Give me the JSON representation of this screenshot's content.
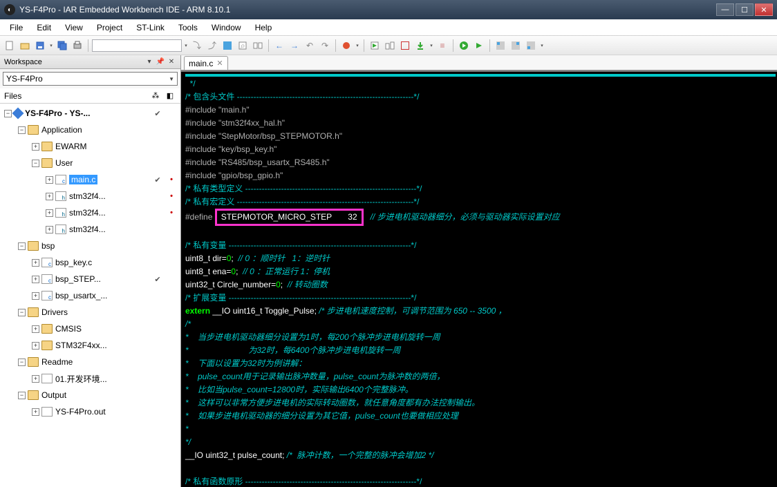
{
  "window": {
    "title": "YS-F4Pro - IAR Embedded Workbench IDE - ARM 8.10.1"
  },
  "menu": [
    "File",
    "Edit",
    "View",
    "Project",
    "ST-Link",
    "Tools",
    "Window",
    "Help"
  ],
  "toolbar": {
    "search_placeholder": ""
  },
  "workspace_panel": {
    "title": "Workspace",
    "selected": "YS-F4Pro"
  },
  "files_panel": {
    "title": "Files"
  },
  "tree": [
    {
      "depth": 0,
      "exp": "-",
      "icon": "cube",
      "label": "YS-F4Pro - YS-...",
      "root": true,
      "cells": [
        "✔",
        ""
      ]
    },
    {
      "depth": 1,
      "exp": "-",
      "icon": "folder",
      "label": "Application",
      "cells": [
        "",
        ""
      ]
    },
    {
      "depth": 2,
      "exp": "+",
      "icon": "folder",
      "label": "EWARM",
      "cells": [
        "",
        ""
      ]
    },
    {
      "depth": 2,
      "exp": "-",
      "icon": "folder",
      "label": "User",
      "cells": [
        "",
        ""
      ]
    },
    {
      "depth": 3,
      "exp": "+",
      "icon": "file-c",
      "label": "main.c",
      "sel": true,
      "cells": [
        "✔",
        "•"
      ]
    },
    {
      "depth": 3,
      "exp": "+",
      "icon": "file-h",
      "label": "stm32f4...",
      "cells": [
        "",
        "•"
      ]
    },
    {
      "depth": 3,
      "exp": "+",
      "icon": "file-h",
      "label": "stm32f4...",
      "cells": [
        "",
        "•"
      ]
    },
    {
      "depth": 3,
      "exp": "+",
      "icon": "file-h",
      "label": "stm32f4...",
      "cells": [
        "",
        ""
      ]
    },
    {
      "depth": 1,
      "exp": "-",
      "icon": "folder",
      "label": "bsp",
      "cells": [
        "",
        ""
      ]
    },
    {
      "depth": 2,
      "exp": "+",
      "icon": "file-c",
      "label": "bsp_key.c",
      "cells": [
        "",
        ""
      ]
    },
    {
      "depth": 2,
      "exp": "+",
      "icon": "file-c",
      "label": "bsp_STEP...",
      "cells": [
        "✔",
        ""
      ]
    },
    {
      "depth": 2,
      "exp": "+",
      "icon": "file-c",
      "label": "bsp_usartx_...",
      "cells": [
        "",
        ""
      ]
    },
    {
      "depth": 1,
      "exp": "-",
      "icon": "folder",
      "label": "Drivers",
      "cells": [
        "",
        ""
      ]
    },
    {
      "depth": 2,
      "exp": "+",
      "icon": "folder",
      "label": "CMSIS",
      "cells": [
        "",
        ""
      ]
    },
    {
      "depth": 2,
      "exp": "+",
      "icon": "folder",
      "label": "STM32F4xx...",
      "cells": [
        "",
        ""
      ]
    },
    {
      "depth": 1,
      "exp": "-",
      "icon": "folder",
      "label": "Readme",
      "cells": [
        "",
        ""
      ]
    },
    {
      "depth": 2,
      "exp": "+",
      "icon": "file",
      "label": "01.开发环境...",
      "cells": [
        "",
        ""
      ]
    },
    {
      "depth": 1,
      "exp": "-",
      "icon": "folder",
      "label": "Output",
      "cells": [
        "",
        ""
      ]
    },
    {
      "depth": 2,
      "exp": "+",
      "icon": "file",
      "label": "YS-F4Pro.out",
      "cells": [
        "",
        ""
      ]
    }
  ],
  "tab": {
    "name": "main.c"
  },
  "code": {
    "l01": "  */",
    "l02": "/* 包含头文件 ----------------------------------------------------------------*/",
    "l03a": "#include ",
    "l03b": "\"main.h\"",
    "l04a": "#include ",
    "l04b": "\"stm32f4xx_hal.h\"",
    "l05a": "#include ",
    "l05b": "\"StepMotor/bsp_STEPMOTOR.h\"",
    "l06a": "#include ",
    "l06b": "\"key/bsp_key.h\"",
    "l07a": "#include ",
    "l07b": "\"RS485/bsp_usartx_RS485.h\"",
    "l08a": "#include ",
    "l08b": "\"gpio/bsp_gpio.h\"",
    "l09": "/* 私有类型定义 --------------------------------------------------------------*/",
    "l10": "/* 私有宏定义 ----------------------------------------------------------------*/",
    "l11a": "#define ",
    "l11b": "STEPMOTOR_MICRO_STEP       32",
    "l11c": "   // 步进电机驱动器细分，必须与驱动器实际设置对应",
    "l12": " ",
    "l13": "/* 私有变量 ------------------------------------------------------------------*/",
    "l14a": "uint8_t dir=",
    "l14b": "0",
    "l14c": ";  ",
    "l14d": "// 0 ：顺时针   1：逆时针",
    "l15a": "uint8_t ena=",
    "l15b": "0",
    "l15c": ";  ",
    "l15d": "// 0 ：正常运行 1：停机",
    "l16a": "uint32_t Circle_number=",
    "l16b": "0",
    "l16c": ";  ",
    "l16d": "// 转动圈数",
    "l17": "/* 扩展变量 ------------------------------------------------------------------*/",
    "l18a": "extern",
    "l18b": " __IO uint16_t Toggle_Pulse; ",
    "l18c": "/* 步进电机速度控制，可调节范围为 650 -- 3500 ，",
    "l19": "/*",
    "l20": "*    当步进电机驱动器细分设置为1时，每200个脉冲步进电机旋转一周",
    "l21": "*                          为32时，每6400个脉冲步进电机旋转一周",
    "l22": "*    下面以设置为32时为例讲解：",
    "l23": "*    pulse_count用于记录输出脉冲数量，pulse_count为脉冲数的两倍，",
    "l24": "*    比如当pulse_count=12800时，实际输出6400个完整脉冲。",
    "l25": "*    这样可以非常方便步进电机的实际转动圈数，就任意角度都有办法控制输出。",
    "l26": "*    如果步进电机驱动器的细分设置为其它值，pulse_count也要做相应处理",
    "l27": "*",
    "l28": "*/",
    "l29a": "__IO uint32_t pulse_count; ",
    "l29b": "/*  脉冲计数，一个完整的脉冲会增加2 */",
    "l30": " ",
    "l31": "/* 私有函数原形 --------------------------------------------------------------*/"
  }
}
